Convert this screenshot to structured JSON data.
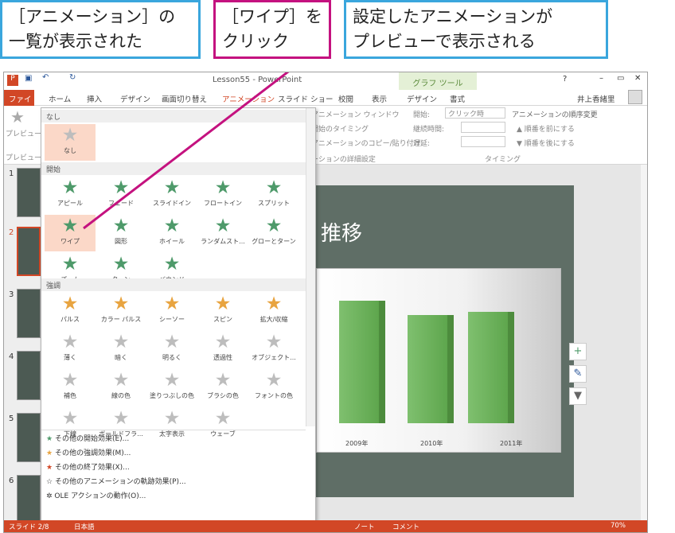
{
  "callouts": {
    "c1": "［アニメーション］の\n一覧が表示された",
    "c2": "［ワイプ］を\nクリック",
    "c3": "設定したアニメーションが\nプレビューで表示される"
  },
  "title": "Lesson55 - PowerPoint",
  "user": "井上香緒里",
  "chart_tools": "グラフ ツール",
  "tabs": [
    "ファイル",
    "ホーム",
    "挿入",
    "デザイン",
    "画面切り替え",
    "アニメーション",
    "スライド ショー",
    "校閲",
    "表示",
    "デザイン",
    "書式"
  ],
  "ribbon": {
    "preview": "プレビュー",
    "anim_window": "アニメーション ウィンドウ",
    "start_timing": "開始のタイミング",
    "copy_paste": "アニメーションのコピー/貼り付け",
    "detail": "ーションの詳細設定",
    "start": "開始:",
    "start_val": "クリック時",
    "duration": "継続時間:",
    "delay": "遅延:",
    "order": "アニメーションの順序変更",
    "earlier": "▲ 順番を前にする",
    "later": "▼ 順番を後にする",
    "timing": "タイミング"
  },
  "gallery": {
    "none_head": "なし",
    "none": "なし",
    "entrance_head": "開始",
    "entrance": [
      "アピール",
      "フェード",
      "スライドイン",
      "フロートイン",
      "スプリット",
      "ワイプ",
      "図形",
      "ホイール",
      "ランダムスト...",
      "グローとターン",
      "ズーム",
      "ターン",
      "バウンド"
    ],
    "emphasis_head": "強調",
    "emphasis": [
      "パルス",
      "カラー パルス",
      "シーソー",
      "スピン",
      "拡大/収縮",
      "薄く",
      "暗く",
      "明るく",
      "透過性",
      "オブジェクト...",
      "補色",
      "線の色",
      "塗りつぶしの色",
      "ブラシの色",
      "フォントの色",
      "下線",
      "ボールドフラ...",
      "太字表示",
      "ウェーブ"
    ],
    "more": [
      "その他の開始効果(E)...",
      "その他の強調効果(M)...",
      "その他の終了効果(X)...",
      "その他のアニメーションの軌跡効果(P)...",
      "OLE アクションの動作(O)..."
    ]
  },
  "slides": [
    "1",
    "2",
    "3",
    "4",
    "5",
    "6"
  ],
  "slide_title": "推移",
  "chart_data": {
    "type": "bar",
    "categories": [
      "2009年",
      "2010年",
      "2011年"
    ],
    "values": [
      100,
      88,
      92
    ]
  },
  "status": {
    "slide": "スライド 2/8",
    "lang": "日本語",
    "notes": "ノート",
    "comments": "コメント",
    "zoom": "70%"
  },
  "colors": {
    "accent": "#d24726",
    "callout_blue": "#3aa6dd",
    "callout_pink": "#c4127f",
    "slide_bg": "#5f6e66"
  }
}
